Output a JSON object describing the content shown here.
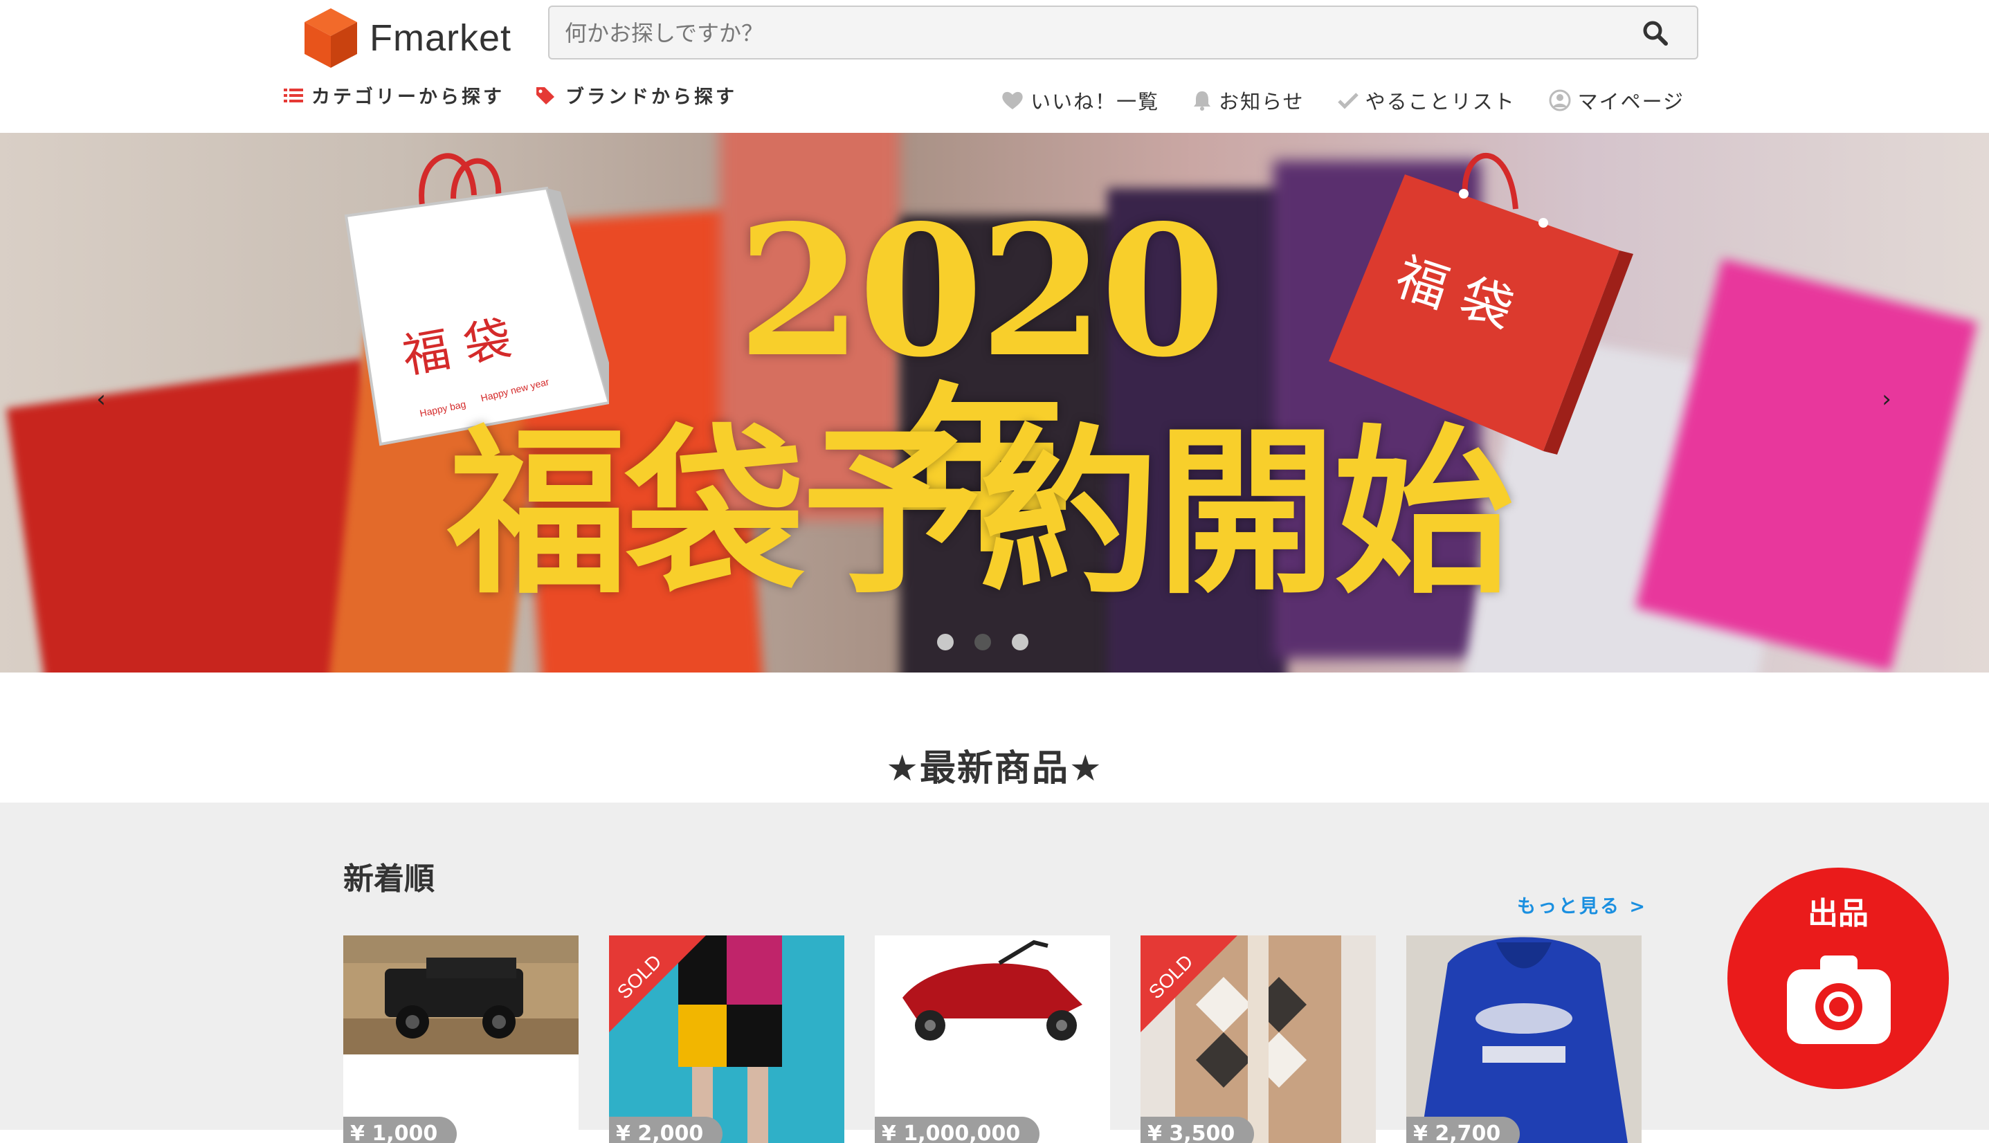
{
  "header": {
    "logo_text": "Fmarket",
    "search": {
      "placeholder": "何かお探しですか？"
    },
    "nav_left": [
      {
        "label": "カテゴリーから探す",
        "icon": "list-icon"
      },
      {
        "label": "ブランドから探す",
        "icon": "tag-icon"
      }
    ],
    "nav_right": [
      {
        "label": "いいね！一覧",
        "icon": "heart-icon"
      },
      {
        "label": "お知らせ",
        "icon": "bell-icon"
      },
      {
        "label": "やることリスト",
        "icon": "check-icon"
      },
      {
        "label": "マイページ",
        "icon": "user-icon"
      }
    ]
  },
  "hero": {
    "title_line1": "2020年",
    "title_line2": "福袋予約開始",
    "bag_text": "福 袋",
    "bag_sub1": "Happy bag",
    "bag_sub2": "Happy new year",
    "prev": "‹",
    "next": "›",
    "slide_count": 3,
    "active_slide": 2
  },
  "latest": {
    "title": "★最新商品★",
    "heading": "新着順",
    "more_link": "もっと見る >",
    "items": [
      {
        "price": "¥ 1,000",
        "sold": false,
        "image": "black-jeep"
      },
      {
        "price": "¥ 2,000",
        "sold": true,
        "sold_label": "SOLD",
        "image": "patchwork-skirt"
      },
      {
        "price": "¥ 1,000,000",
        "sold": false,
        "image": "red-scooter"
      },
      {
        "price": "¥ 3,500",
        "sold": true,
        "sold_label": "SOLD",
        "image": "argyle-cardigan"
      },
      {
        "price": "¥ 2,700",
        "sold": false,
        "image": "blue-university-hoodie"
      }
    ]
  },
  "sell_button": {
    "label": "出品",
    "icon": "camera-icon"
  },
  "colors": {
    "brand_red": "#ea1b1b",
    "link_blue": "#1a8fe0",
    "hero_yellow": "#f8cf2b",
    "logo_orange": "#e8541b"
  }
}
